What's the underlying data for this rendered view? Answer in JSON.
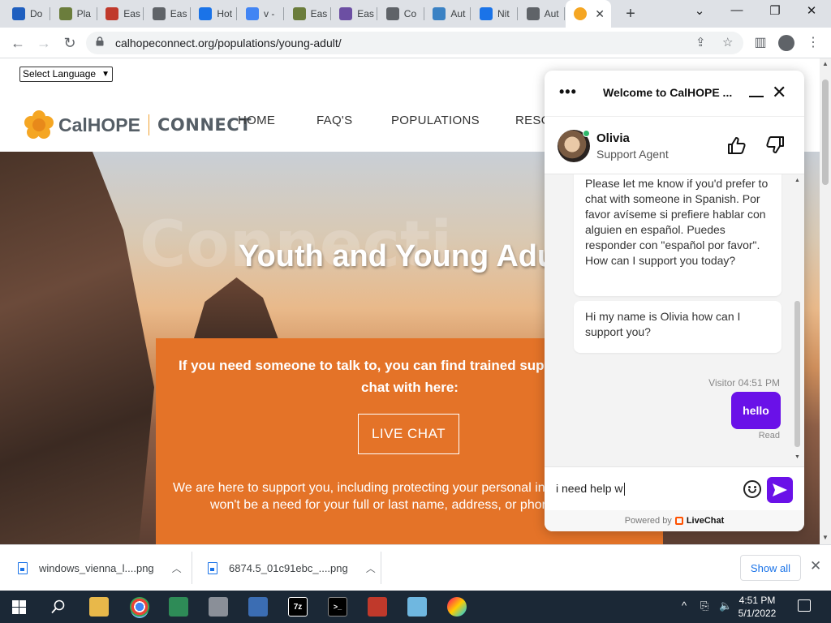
{
  "browser": {
    "tabs": [
      {
        "label": "Do",
        "fav_color": "#1f5fbf",
        "icon": "bird-icon"
      },
      {
        "label": "Pla",
        "fav_color": "#6b7d3c",
        "icon": "plant-icon"
      },
      {
        "label": "Eas",
        "fav_color": "#c0392b",
        "icon": "bug-icon"
      },
      {
        "label": "Eas",
        "fav_color": "#5f6368",
        "icon": "globe-icon"
      },
      {
        "label": "Hot",
        "fav_color": "#1a73e8",
        "icon": "house-icon"
      },
      {
        "label": "v -",
        "fav_color": "#4285f4",
        "icon": "google-icon"
      },
      {
        "label": "Eas",
        "fav_color": "#6b7d3c",
        "icon": "plant-icon"
      },
      {
        "label": "Eas",
        "fav_color": "#6c4fa3",
        "icon": "car-icon"
      },
      {
        "label": "Co",
        "fav_color": "#5f6368",
        "icon": "globe-icon"
      },
      {
        "label": "Aut",
        "fav_color": "#3b82c4",
        "icon": "gear-icon"
      },
      {
        "label": "Nit",
        "fav_color": "#1a73e8",
        "icon": "flame-icon"
      },
      {
        "label": "Aut",
        "fav_color": "#5f6368",
        "icon": "globe-icon"
      }
    ],
    "active_tab": {
      "fav_color": "#f5a623",
      "close": "✕"
    },
    "new_tab": "+",
    "url": "calhopeconnect.org/populations/young-adult/"
  },
  "site": {
    "language_select": "Select Language",
    "brand_left": "CalHOPE",
    "brand_right": "CONNECT",
    "nav": [
      "HOME",
      "FAQ'S",
      "POPULATIONS",
      "RESO"
    ],
    "hero_ghost": "Connecti",
    "hero_title": "Youth and Young Adu",
    "box_line1": "If you need someone to talk to, you can find trained supp",
    "box_line2": "chat with here:",
    "live_chat_button": "LIVE CHAT",
    "box_line3": "We are here to support you, including protecting your personal in",
    "box_line4": "won't be a need for your full or last name, address, or phon"
  },
  "chat": {
    "header_title": "Welcome to CalHOPE ...",
    "agent_name": "Olivia",
    "agent_role": "Support Agent",
    "message1": "Please let me know if you'd prefer to chat with someone in Spanish. Por favor avíseme si prefiere hablar con alguien en español. Puedes responder con \"español por favor\". How can I support you today?",
    "message2": "Hi my name is Olivia how can I support you?",
    "visitor_meta": "Visitor 04:51 PM",
    "visitor_message": "hello",
    "read_status": "Read",
    "input_value": "i need help w",
    "powered_by": "Powered by",
    "powered_brand": "LiveChat",
    "accent_color": "#6a11e8"
  },
  "downloads": {
    "items": [
      "windows_vienna_l....png",
      "6874.5_01c91ebc_....png"
    ],
    "show_all": "Show all"
  },
  "taskbar": {
    "time": "4:51 PM",
    "date": "5/1/2022"
  }
}
